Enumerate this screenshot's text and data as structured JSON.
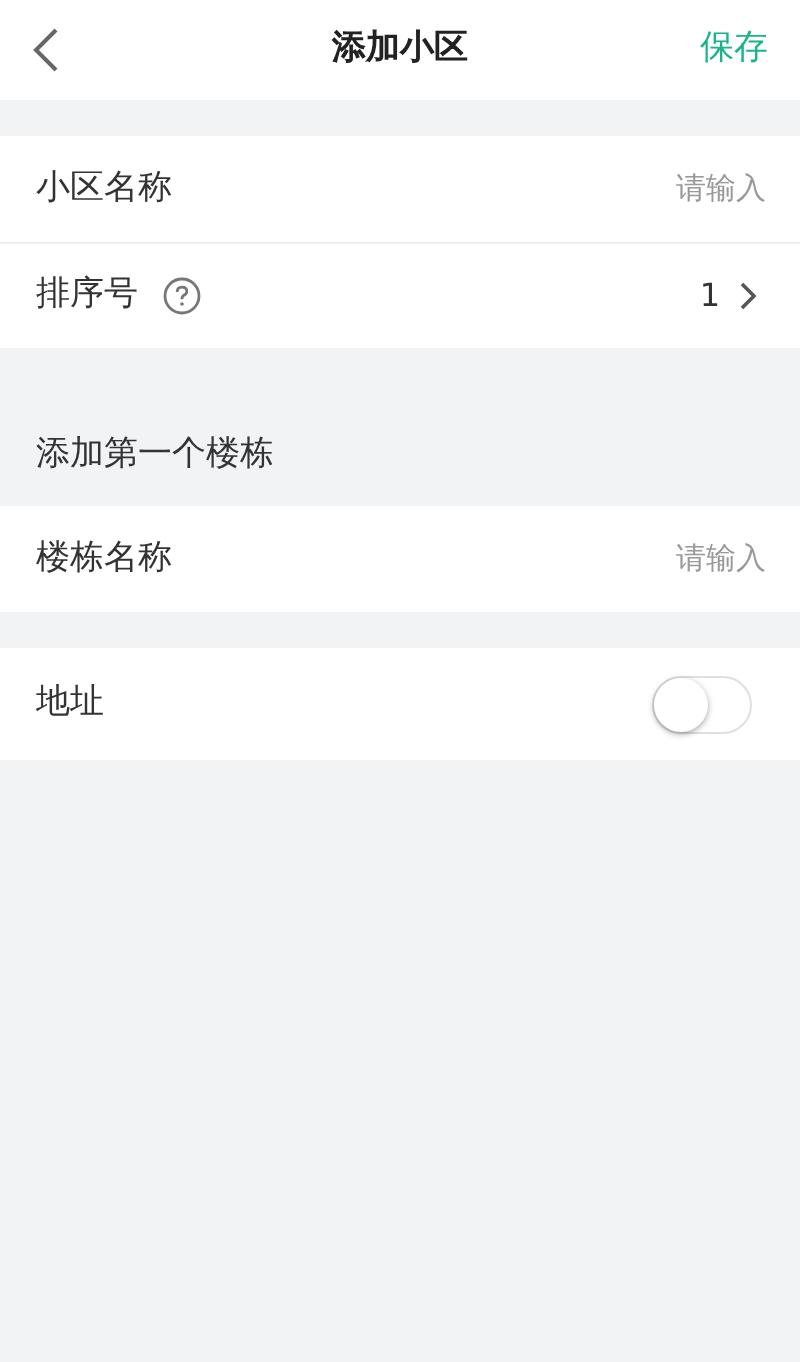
{
  "header": {
    "title": "添加小区",
    "action": "保存"
  },
  "sections": [
    {
      "rows": [
        {
          "kind": "input",
          "label": "小区名称",
          "placeholder": "请输入"
        },
        {
          "kind": "select",
          "label": "排序号",
          "help": true,
          "value": "1"
        }
      ]
    },
    {
      "title": "添加第一个楼栋",
      "rows": [
        {
          "kind": "input",
          "label": "楼栋名称",
          "placeholder": "请输入"
        }
      ]
    },
    {
      "rows": [
        {
          "kind": "toggle",
          "label": "地址",
          "on": false
        }
      ]
    }
  ]
}
